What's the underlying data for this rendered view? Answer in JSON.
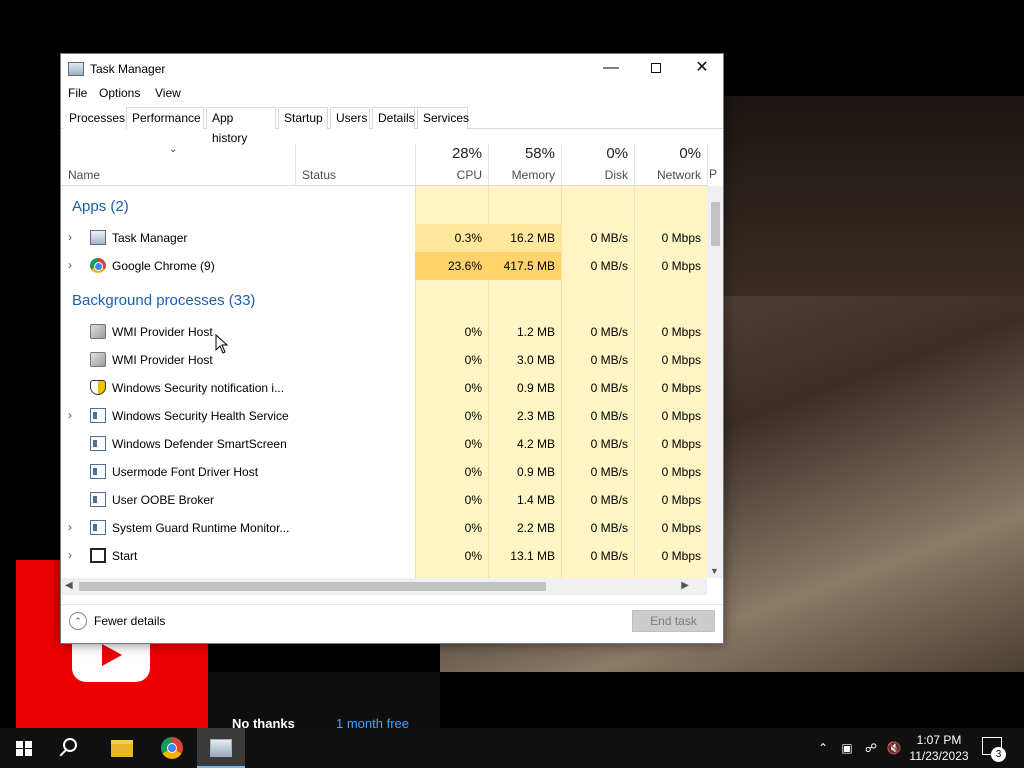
{
  "window": {
    "title": "Task Manager",
    "controls": {
      "minimize": "—",
      "close": "✕"
    }
  },
  "menu": [
    "File",
    "Options",
    "View"
  ],
  "tabs": [
    "Processes",
    "Performance",
    "App history",
    "Startup",
    "Users",
    "Details",
    "Services"
  ],
  "columns": {
    "name": "Name",
    "status": "Status",
    "cpu": {
      "pct": "28%",
      "label": "CPU"
    },
    "memory": {
      "pct": "58%",
      "label": "Memory"
    },
    "disk": {
      "pct": "0%",
      "label": "Disk"
    },
    "network": {
      "pct": "0%",
      "label": "Network"
    },
    "overflow": "P"
  },
  "groups": {
    "apps": "Apps (2)",
    "background": "Background processes (33)"
  },
  "apps": [
    {
      "name": "Task Manager",
      "cpu": "0.3%",
      "memory": "16.2 MB",
      "disk": "0 MB/s",
      "network": "0 Mbps"
    },
    {
      "name": "Google Chrome (9)",
      "cpu": "23.6%",
      "memory": "417.5 MB",
      "disk": "0 MB/s",
      "network": "0 Mbps"
    }
  ],
  "background": [
    {
      "name": "WMI Provider Host",
      "cpu": "0%",
      "memory": "1.2 MB",
      "disk": "0 MB/s",
      "network": "0 Mbps"
    },
    {
      "name": "WMI Provider Host",
      "cpu": "0%",
      "memory": "3.0 MB",
      "disk": "0 MB/s",
      "network": "0 Mbps"
    },
    {
      "name": "Windows Security notification i...",
      "cpu": "0%",
      "memory": "0.9 MB",
      "disk": "0 MB/s",
      "network": "0 Mbps"
    },
    {
      "name": "Windows Security Health Service",
      "cpu": "0%",
      "memory": "2.3 MB",
      "disk": "0 MB/s",
      "network": "0 Mbps"
    },
    {
      "name": "Windows Defender SmartScreen",
      "cpu": "0%",
      "memory": "4.2 MB",
      "disk": "0 MB/s",
      "network": "0 Mbps"
    },
    {
      "name": "Usermode Font Driver Host",
      "cpu": "0%",
      "memory": "0.9 MB",
      "disk": "0 MB/s",
      "network": "0 Mbps"
    },
    {
      "name": "User OOBE Broker",
      "cpu": "0%",
      "memory": "1.4 MB",
      "disk": "0 MB/s",
      "network": "0 Mbps"
    },
    {
      "name": "System Guard Runtime Monitor...",
      "cpu": "0%",
      "memory": "2.2 MB",
      "disk": "0 MB/s",
      "network": "0 Mbps"
    },
    {
      "name": "Start",
      "cpu": "0%",
      "memory": "13.1 MB",
      "disk": "0 MB/s",
      "network": "0 Mbps"
    }
  ],
  "footer": {
    "fewer_details": "Fewer details",
    "end_task": "End task"
  },
  "promo": {
    "no_thanks": "No thanks",
    "month_free": "1 month free"
  },
  "taskbar": {
    "time": "1:07 PM",
    "date": "11/23/2023",
    "notification_count": "3"
  },
  "colors": {
    "heat_light": "#fff4c4",
    "heat_mid": "#ffe79b",
    "heat_high": "#ffd26a",
    "group_blue": "#1e5fa8",
    "taskbar": "#101010"
  },
  "icons": {
    "cpu_sort": "chevron-down-icon",
    "windows": "windows-start-icon",
    "search": "search-icon",
    "explorer": "folder-icon",
    "chrome": "chrome-icon",
    "taskmgr": "task-manager-icon"
  }
}
